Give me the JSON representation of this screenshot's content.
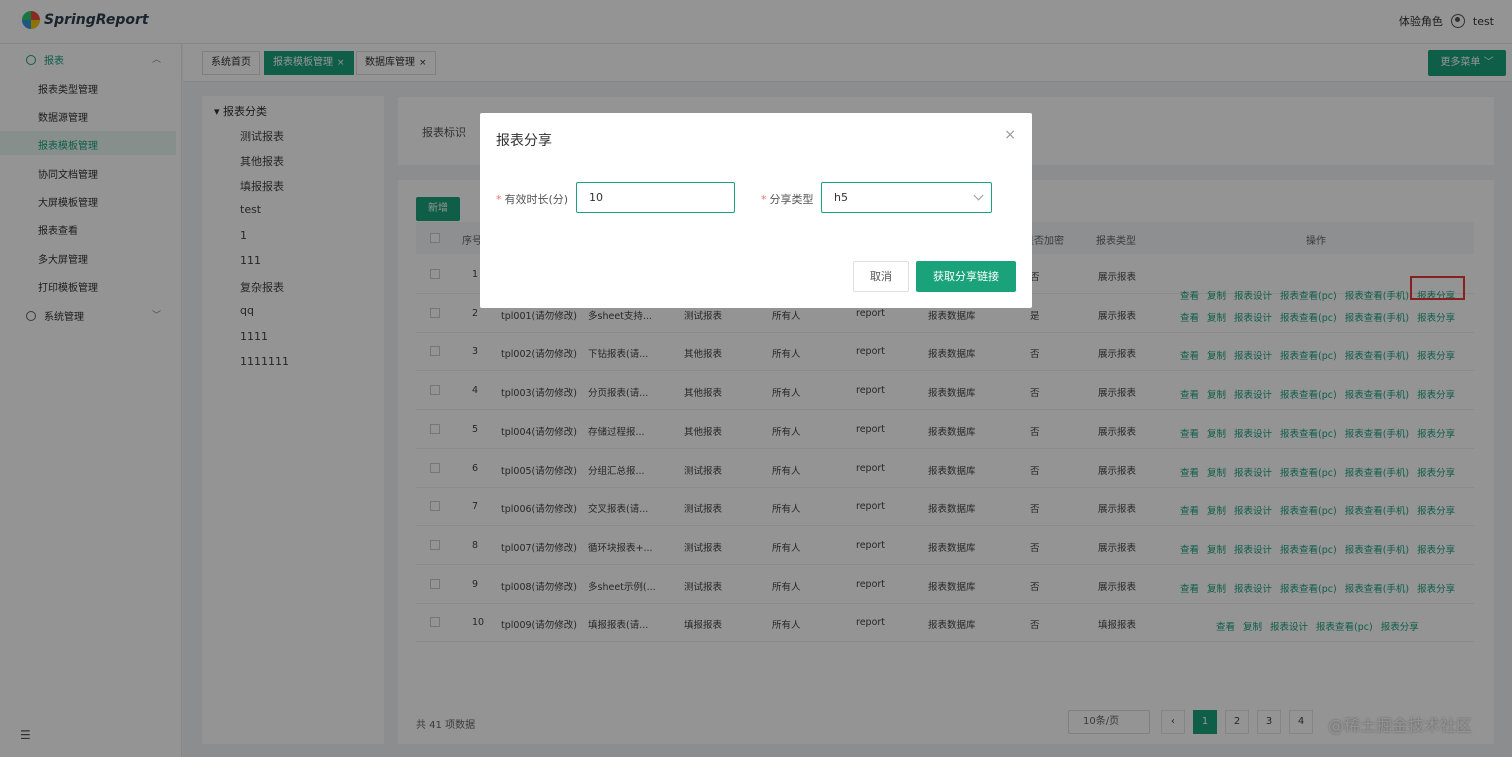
{
  "app": {
    "logo_text": "SpringReport"
  },
  "user": {
    "role": "体验角色",
    "name": "test"
  },
  "sidebar": {
    "groups": [
      {
        "label": "报表"
      },
      {
        "label": "系统管理"
      }
    ],
    "items": [
      {
        "label": "报表类型管理"
      },
      {
        "label": "数据源管理"
      },
      {
        "label": "报表模板管理"
      },
      {
        "label": "协同文档管理"
      },
      {
        "label": "大屏模板管理"
      },
      {
        "label": "报表查看"
      },
      {
        "label": "多大屏管理"
      },
      {
        "label": "打印模板管理"
      }
    ]
  },
  "tabs": [
    {
      "label": "系统首页"
    },
    {
      "label": "报表模板管理",
      "close": "×"
    },
    {
      "label": "数据库管理",
      "close": "×"
    }
  ],
  "more_menu": "更多菜单",
  "tree": {
    "root": "报表分类",
    "items": [
      "测试报表",
      "其他报表",
      "填报报表",
      "test",
      "1",
      "111",
      "复杂报表",
      "qq",
      "1111",
      "1111111"
    ]
  },
  "search": {
    "label": "报表标识"
  },
  "table": {
    "add_label": "新增",
    "headers": {
      "seq": "序号",
      "encrypt": "是否加密",
      "type": "报表类型",
      "ops": "操作"
    },
    "op_labels": [
      "查看",
      "复制",
      "报表设计",
      "报表查看(pc)",
      "报表查看(手机)",
      "报表分享"
    ],
    "op_labels_short": [
      "查看",
      "复制",
      "报表设计",
      "报表查看(pc)",
      "报表分享"
    ],
    "rows": [
      {
        "no": "1",
        "code": "",
        "name": "",
        "cat": "",
        "perm": "",
        "ds": "",
        "db": "",
        "enc": "否",
        "type": "展示报表"
      },
      {
        "no": "2",
        "code": "tpl001(请勿修改)",
        "name": "多sheet支持...",
        "cat": "测试报表",
        "perm": "所有人",
        "ds": "report",
        "db": "报表数据库",
        "enc": "是",
        "type": "展示报表"
      },
      {
        "no": "3",
        "code": "tpl002(请勿修改)",
        "name": "下钻报表(请...",
        "cat": "其他报表",
        "perm": "所有人",
        "ds": "report",
        "db": "报表数据库",
        "enc": "否",
        "type": "展示报表"
      },
      {
        "no": "4",
        "code": "tpl003(请勿修改)",
        "name": "分页报表(请...",
        "cat": "其他报表",
        "perm": "所有人",
        "ds": "report",
        "db": "报表数据库",
        "enc": "否",
        "type": "展示报表"
      },
      {
        "no": "5",
        "code": "tpl004(请勿修改)",
        "name": "存储过程报...",
        "cat": "其他报表",
        "perm": "所有人",
        "ds": "report",
        "db": "报表数据库",
        "enc": "否",
        "type": "展示报表"
      },
      {
        "no": "6",
        "code": "tpl005(请勿修改)",
        "name": "分组汇总报...",
        "cat": "测试报表",
        "perm": "所有人",
        "ds": "report",
        "db": "报表数据库",
        "enc": "否",
        "type": "展示报表"
      },
      {
        "no": "7",
        "code": "tpl006(请勿修改)",
        "name": "交叉报表(请...",
        "cat": "测试报表",
        "perm": "所有人",
        "ds": "report",
        "db": "报表数据库",
        "enc": "否",
        "type": "展示报表"
      },
      {
        "no": "8",
        "code": "tpl007(请勿修改)",
        "name": "循环块报表+...",
        "cat": "测试报表",
        "perm": "所有人",
        "ds": "report",
        "db": "报表数据库",
        "enc": "否",
        "type": "展示报表"
      },
      {
        "no": "9",
        "code": "tpl008(请勿修改)",
        "name": "多sheet示例(...",
        "cat": "测试报表",
        "perm": "所有人",
        "ds": "report",
        "db": "报表数据库",
        "enc": "否",
        "type": "展示报表"
      },
      {
        "no": "10",
        "code": "tpl009(请勿修改)",
        "name": "填报报表(请...",
        "cat": "填报报表",
        "perm": "所有人",
        "ds": "report",
        "db": "报表数据库",
        "enc": "否",
        "type": "填报报表"
      }
    ],
    "total": "共 41 项数据",
    "page_size": "10条/页",
    "pages": [
      "‹",
      "1",
      "2",
      "3",
      "4"
    ]
  },
  "watermark": "@稀土掘金技术社区",
  "dialog": {
    "title": "报表分享",
    "close": "×",
    "duration_label": "有效时长(分)",
    "duration_value": "10",
    "share_type_label": "分享类型",
    "share_type_value": "h5",
    "required_mark": "*",
    "cancel": "取消",
    "confirm": "获取分享链接"
  }
}
